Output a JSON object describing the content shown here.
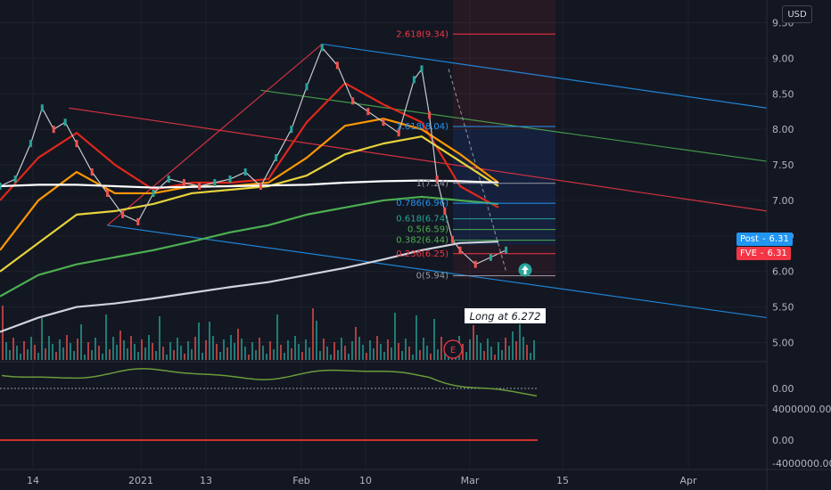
{
  "header": {
    "currency": "USD"
  },
  "colors": {
    "background": "#131722",
    "grid": "#1e222d",
    "fast_ma": "#e0271b",
    "mid_ma": "#ff9800",
    "slow_ma": "#e6d33b",
    "ma_100": "#ffffff",
    "ma_200": "#4caf50",
    "channel_red": "#f23645",
    "channel_green": "#4caf50",
    "channel_blue": "#2196f3",
    "candle_up": "#26a69a",
    "candle_down": "#ef5350",
    "post_tag": "#2196f3",
    "fve_tag": "#f23645"
  },
  "annotation": {
    "long_label": "Long at 6.272",
    "earnings_marker": "E",
    "signal_icon": "arrow-up-circle-icon"
  },
  "tags": [
    {
      "name": "Post",
      "value": "6.31"
    },
    {
      "name": "FVE",
      "value": "6.31"
    }
  ],
  "fib_levels": [
    {
      "ratio": "2.618",
      "price": 9.34,
      "label": "2.618(9.34)"
    },
    {
      "ratio": "1.618",
      "price": 8.04,
      "label": "1.618(8.04)"
    },
    {
      "ratio": "1",
      "price": 7.24,
      "label": "1(7.24)"
    },
    {
      "ratio": "0.786",
      "price": 6.96,
      "label": "0.786(6.96)"
    },
    {
      "ratio": "0.618",
      "price": 6.74,
      "label": "0.618(6.74)"
    },
    {
      "ratio": "0.5",
      "price": 6.59,
      "label": "0.5(6.59)"
    },
    {
      "ratio": "0.382",
      "price": 6.44,
      "label": "0.382(6.44)"
    },
    {
      "ratio": "0.236",
      "price": 6.25,
      "label": "0.236(6.25)"
    },
    {
      "ratio": "0",
      "price": 5.94,
      "label": "0(5.94)"
    }
  ],
  "chart_data": {
    "type": "line",
    "price_axis": {
      "ticks": [
        "9.50",
        "9.00",
        "8.50",
        "8.00",
        "7.50",
        "7.00",
        "6.50",
        "6.00",
        "5.50",
        "5.00"
      ],
      "range": [
        4.73,
        9.82
      ]
    },
    "oscillator_axis": {
      "ticks": [
        "0.00"
      ]
    },
    "volume_axis": {
      "ticks": [
        "4000000.00",
        "0.00",
        "-4000000.00"
      ]
    },
    "time_axis": {
      "ticks": [
        "14",
        "2021",
        "13",
        "Feb",
        "10",
        "Mar",
        "15",
        "Apr"
      ]
    },
    "x_range": [
      0,
      100
    ],
    "price_series": {
      "x": [
        0,
        2,
        4,
        5.5,
        7,
        8.5,
        10,
        12,
        14,
        16,
        18,
        20,
        22,
        24,
        26,
        28,
        30,
        32,
        34,
        36,
        38,
        40,
        42,
        44,
        46,
        48,
        50,
        52,
        54,
        55,
        56,
        57,
        58,
        59,
        60,
        62,
        64,
        66
      ],
      "y": [
        7.2,
        7.3,
        7.8,
        8.3,
        8.0,
        8.1,
        7.8,
        7.4,
        7.1,
        6.8,
        6.7,
        7.1,
        7.3,
        7.25,
        7.2,
        7.25,
        7.3,
        7.4,
        7.2,
        7.6,
        8.0,
        8.6,
        9.15,
        8.9,
        8.4,
        8.25,
        8.1,
        7.95,
        8.7,
        8.85,
        8.2,
        7.3,
        6.85,
        6.45,
        6.3,
        6.1,
        6.2,
        6.3
      ]
    },
    "moving_averages": [
      {
        "x": [
          0,
          5,
          10,
          15,
          20,
          25,
          30,
          35,
          40,
          45,
          50,
          55,
          60,
          65
        ],
        "y": [
          7.0,
          7.6,
          7.95,
          7.5,
          7.15,
          7.25,
          7.25,
          7.3,
          8.1,
          8.65,
          8.35,
          8.1,
          7.2,
          6.9
        ]
      },
      {
        "x": [
          0,
          5,
          10,
          15,
          20,
          25,
          30,
          35,
          40,
          45,
          50,
          55,
          60,
          65
        ],
        "y": [
          6.3,
          7.0,
          7.4,
          7.1,
          7.1,
          7.2,
          7.2,
          7.25,
          7.6,
          8.05,
          8.15,
          8.0,
          7.65,
          7.25
        ]
      },
      {
        "x": [
          0,
          5,
          10,
          15,
          20,
          25,
          30,
          35,
          40,
          45,
          50,
          55,
          60,
          65
        ],
        "y": [
          6.0,
          6.4,
          6.8,
          6.85,
          6.95,
          7.1,
          7.15,
          7.2,
          7.35,
          7.65,
          7.8,
          7.9,
          7.55,
          7.2
        ]
      },
      {
        "x": [
          0,
          5,
          10,
          15,
          20,
          25,
          30,
          35,
          40,
          45,
          50,
          55,
          60,
          65
        ],
        "y": [
          7.2,
          7.22,
          7.22,
          7.2,
          7.18,
          7.19,
          7.2,
          7.21,
          7.22,
          7.25,
          7.27,
          7.28,
          7.27,
          7.25
        ]
      },
      {
        "x": [
          0,
          5,
          10,
          15,
          20,
          25,
          30,
          35,
          40,
          45,
          50,
          55,
          60,
          65
        ],
        "y": [
          5.65,
          5.95,
          6.1,
          6.2,
          6.3,
          6.42,
          6.55,
          6.65,
          6.8,
          6.9,
          7.0,
          7.05,
          7.0,
          6.95
        ]
      },
      {
        "x": [
          0,
          5,
          10,
          15,
          20,
          25,
          30,
          35,
          40,
          45,
          50,
          55,
          60,
          65
        ],
        "y": [
          5.15,
          5.35,
          5.5,
          5.55,
          5.62,
          5.7,
          5.78,
          5.85,
          5.95,
          6.05,
          6.17,
          6.3,
          6.4,
          6.42
        ]
      }
    ],
    "channels": [
      {
        "x": [
          9,
          100
        ],
        "y": [
          8.3,
          6.85
        ]
      },
      {
        "x": [
          34,
          100
        ],
        "y": [
          8.55,
          7.55
        ]
      },
      {
        "x": [
          42,
          100
        ],
        "y": [
          9.2,
          8.3
        ]
      },
      {
        "x": [
          14,
          100
        ],
        "y": [
          6.65,
          5.35
        ]
      },
      {
        "x": [
          14,
          42
        ],
        "y": [
          6.65,
          9.2
        ]
      }
    ]
  }
}
